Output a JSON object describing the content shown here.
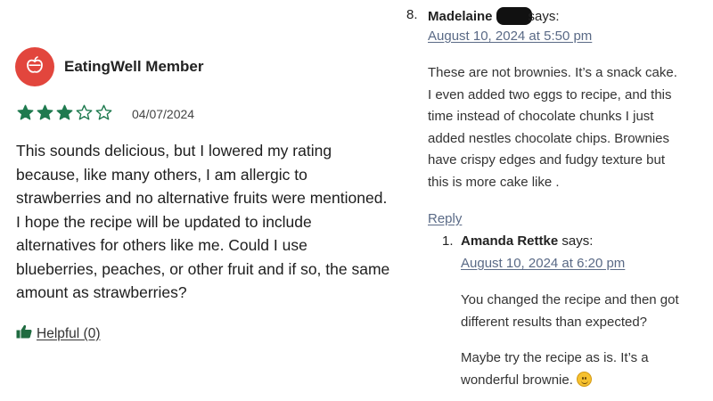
{
  "review": {
    "member_name": "EatingWell Member",
    "rating": 3,
    "rating_max": 5,
    "date": "04/07/2024",
    "body": "This sounds delicious, but I lowered my rating because, like many others, I am allergic to strawberries and no alternative fruits were mentioned. I hope the recipe will be updated to include alternatives for others like me. Could I use blueberries, peaches, or other fruit and if so, the same amount as strawberries?",
    "helpful_label": "Helpful (0)",
    "avatar_icon": "apple-icon",
    "colors": {
      "avatar_bg": "#e2463d",
      "star": "#1f7a4f",
      "helpful_icon": "#1f6b40"
    }
  },
  "comment": {
    "number": "8.",
    "author": "Madelaine",
    "says": "says:",
    "date": "August 10, 2024 at 5:50 pm",
    "lines": [
      "These are not brownies. It’s a snack cake.",
      "I even added two eggs to recipe, and this",
      "time instead of chocolate chunks I just",
      "added nestles chocolate chips. Brownies",
      "have crispy edges and fudgy texture but",
      "this is more cake like ."
    ],
    "reply_label": "Reply"
  },
  "reply_comment": {
    "number": "1.",
    "author": "Amanda Rettke",
    "says": "says:",
    "date": "August 10, 2024 at 6:20 pm",
    "para1_lines": [
      "You changed the recipe and then got",
      "different results than expected?"
    ],
    "para2_line1": "Maybe try the recipe as is. It’s a",
    "para2_line2": "wonderful brownie.",
    "emoji_icon": "smiley-emoji-icon"
  }
}
